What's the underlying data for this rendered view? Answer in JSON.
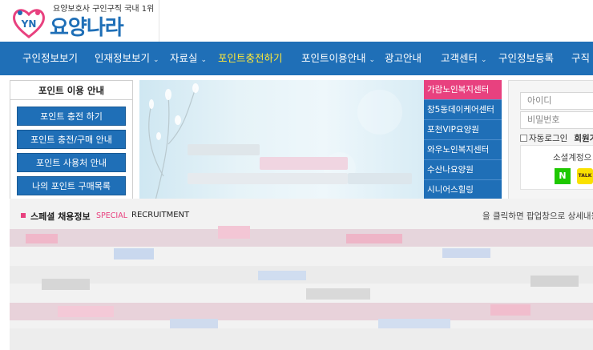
{
  "header": {
    "tagline": "요양보호사 구인구직 국내 1위",
    "logo_badge": "YN",
    "logo_name": "요양나라"
  },
  "nav": {
    "items": [
      {
        "label": "구인정보보기",
        "active": false,
        "caret": false
      },
      {
        "label": "인재정보보기",
        "active": false,
        "caret": true
      },
      {
        "label": "자료실",
        "active": false,
        "caret": true
      },
      {
        "label": "포인트충전하기",
        "active": true,
        "caret": false
      },
      {
        "label": "포인트이용안내",
        "active": false,
        "caret": true
      },
      {
        "label": "광고안내",
        "active": false,
        "caret": false
      },
      {
        "label": "고객센터",
        "active": false,
        "caret": true
      },
      {
        "label": "구인정보등록",
        "active": false,
        "caret": false
      },
      {
        "label": "구직",
        "active": false,
        "caret": false
      }
    ]
  },
  "point_box": {
    "title": "포인트 이용 안내",
    "buttons": [
      "포인트 충전 하기",
      "포인트 충전/구매 안내",
      "포인트 사용처 안내",
      "나의 포인트 구매목록"
    ]
  },
  "facilities": {
    "items": [
      {
        "label": "가람노인복지센터",
        "active": true
      },
      {
        "label": "창5동데이케어센터",
        "active": false
      },
      {
        "label": "포천VIP요양원",
        "active": false
      },
      {
        "label": "와우노인복지센터",
        "active": false
      },
      {
        "label": "수산나요양원",
        "active": false
      },
      {
        "label": "시니어스힐링",
        "active": false
      }
    ]
  },
  "login": {
    "id_placeholder": "아이디",
    "pw_placeholder": "비밀번호",
    "auto_login": "자동로그인",
    "join": "회원가",
    "social_label": "소셜계정으",
    "naver": "N",
    "kakao": "TALK"
  },
  "special": {
    "title": "스페셜 채용정보",
    "tag": "SPECIAL",
    "tag2": "RECRUITMENT",
    "note": "을 클릭하면 팝업창으로 상세내용을 보"
  },
  "colors": {
    "primary": "#1f6fb7",
    "accent": "#e8417f",
    "active_nav": "#ffe838"
  }
}
